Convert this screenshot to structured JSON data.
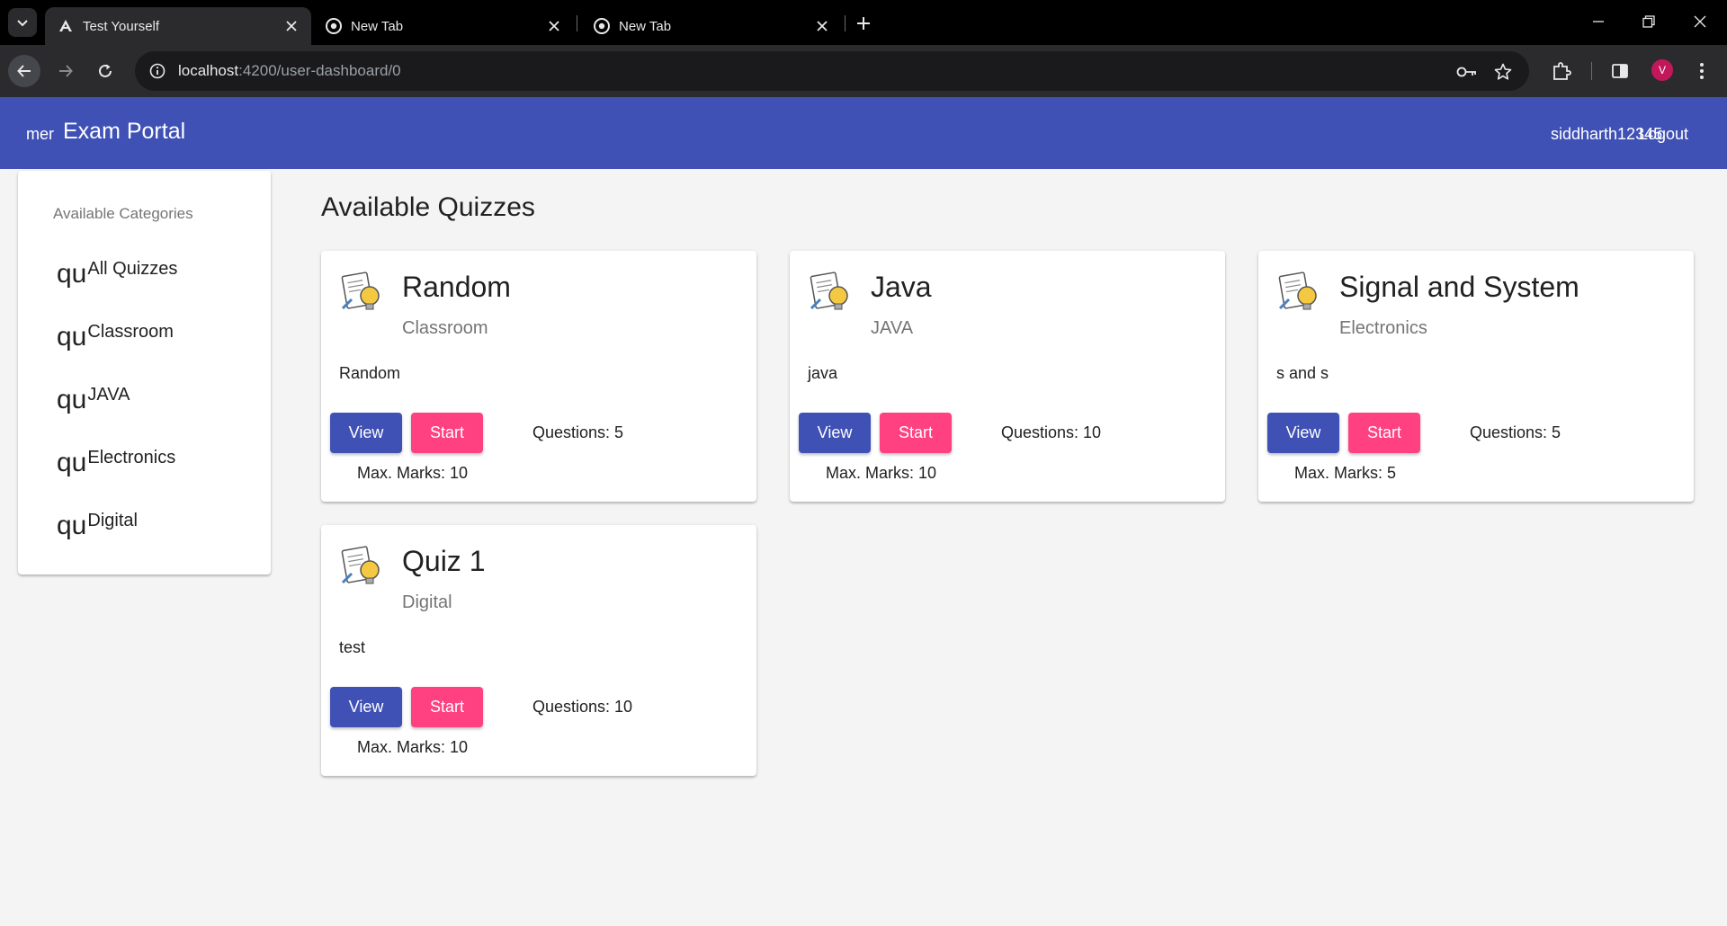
{
  "browser": {
    "tabs": [
      {
        "title": "Test Yourself",
        "icon": "angular-icon",
        "active": true
      },
      {
        "title": "New Tab",
        "icon": "chrome-icon",
        "active": false
      },
      {
        "title": "New Tab",
        "icon": "chrome-icon",
        "active": false
      }
    ],
    "url_host": "localhost",
    "url_path": ":4200/user-dashboard/0",
    "profile_initial": "V"
  },
  "app": {
    "menu_text": "mer",
    "title": "Exam Portal",
    "username": "siddharth12345",
    "logout_label": "Logout"
  },
  "sidebar": {
    "header": "Available Categories",
    "icon_text": "qu",
    "items": [
      {
        "label": "All Quizzes"
      },
      {
        "label": "Classroom"
      },
      {
        "label": "JAVA"
      },
      {
        "label": "Electronics"
      },
      {
        "label": "Digital"
      }
    ]
  },
  "main": {
    "title": "Available Quizzes",
    "view_label": "View",
    "start_label": "Start",
    "questions_prefix": "Questions: ",
    "marks_prefix": "Max. Marks: ",
    "quizzes": [
      {
        "title": "Random",
        "category": "Classroom",
        "description": "Random",
        "questions": "5",
        "max_marks": "10"
      },
      {
        "title": "Java",
        "category": "JAVA",
        "description": "java",
        "questions": "10",
        "max_marks": "10"
      },
      {
        "title": "Signal and System",
        "category": "Electronics",
        "description": "s and s",
        "questions": "5",
        "max_marks": "5"
      },
      {
        "title": "Quiz 1",
        "category": "Digital",
        "description": "test",
        "questions": "10",
        "max_marks": "10"
      }
    ]
  },
  "colors": {
    "primary": "#3f51b5",
    "accent": "#ff4081"
  }
}
